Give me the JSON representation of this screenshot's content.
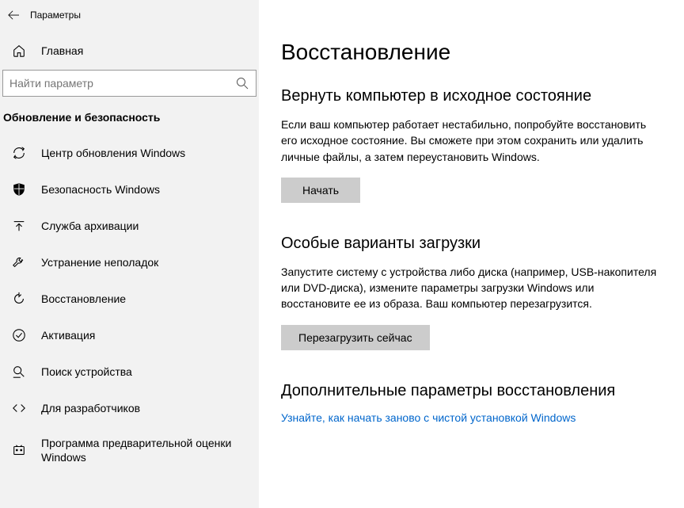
{
  "window_title": "Параметры",
  "sidebar": {
    "home_label": "Главная",
    "search_placeholder": "Найти параметр",
    "section_title": "Обновление и безопасность",
    "items": [
      {
        "label": "Центр обновления Windows"
      },
      {
        "label": "Безопасность Windows"
      },
      {
        "label": "Служба архивации"
      },
      {
        "label": "Устранение неполадок"
      },
      {
        "label": "Восстановление"
      },
      {
        "label": "Активация"
      },
      {
        "label": "Поиск устройства"
      },
      {
        "label": "Для разработчиков"
      },
      {
        "label": "Программа предварительной оценки Windows"
      }
    ]
  },
  "page": {
    "title": "Восстановление",
    "sections": [
      {
        "heading": "Вернуть компьютер в исходное состояние",
        "body": "Если ваш компьютер работает нестабильно, попробуйте восстановить его исходное состояние. Вы сможете при этом сохранить или удалить личные файлы, а затем переустановить Windows.",
        "button": "Начать"
      },
      {
        "heading": "Особые варианты загрузки",
        "body": "Запустите систему с устройства либо диска (например, USB-накопителя или DVD-диска), измените параметры загрузки Windows или восстановите ее из образа. Ваш компьютер перезагрузится.",
        "button": "Перезагрузить сейчас"
      },
      {
        "heading": "Дополнительные параметры восстановления",
        "link": "Узнайте, как начать заново с чистой установкой Windows"
      }
    ]
  }
}
